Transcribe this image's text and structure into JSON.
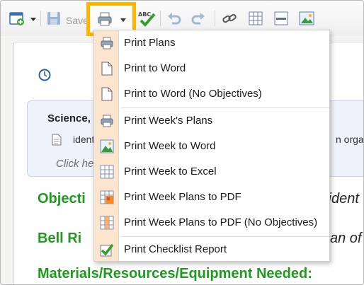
{
  "toolbar": {
    "save_label": "Save"
  },
  "print_menu": {
    "items": [
      {
        "label": "Print Plans",
        "icon": "printer-icon"
      },
      {
        "label": "Print to Word",
        "icon": "blank-document-icon"
      },
      {
        "label": "Print to Word (No Objectives)",
        "icon": "blank-document-icon"
      },
      {
        "label": "Print Week's Plans",
        "icon": "printer-icon"
      },
      {
        "label": "Print Week to Word",
        "icon": "image-document-icon"
      },
      {
        "label": "Print Week to Excel",
        "icon": "grid-icon"
      },
      {
        "label": "Print Week Plans to PDF",
        "icon": "pdf-calendar-icon"
      },
      {
        "label": "Print Week Plans to PDF (No Objectives)",
        "icon": "pdf-calendar-icon"
      },
      {
        "label": "Print Checklist Report",
        "icon": "checkbox-icon"
      }
    ]
  },
  "lesson": {
    "card_title": "Science, G",
    "card_line": "identify",
    "card_line_right": "n orga",
    "click_here": "Click here",
    "objectives_heading": "Objecti",
    "objectives_right": "fident",
    "bell_ringer_heading": "Bell Ri",
    "bell_ringer_right": "an of",
    "materials_heading": "Materials/Resources/Equipment Needed:"
  },
  "colors": {
    "highlight": "#ffb400",
    "heading_green": "#1f9a1f",
    "menu_gutter": "#fbe5cf"
  }
}
